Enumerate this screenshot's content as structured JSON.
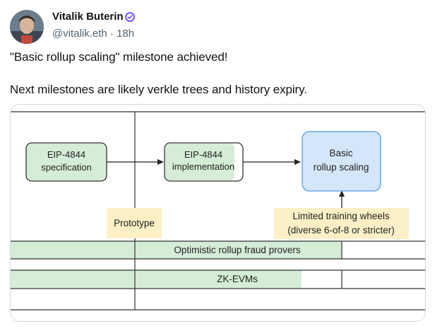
{
  "author": {
    "name": "Vitalik Buterin",
    "handle_time": "@vitalik.eth · 18h"
  },
  "tweet": {
    "line1": "\"Basic rollup scaling\" milestone achieved!",
    "line2": "Next milestones are likely verkle trees and history expiry."
  },
  "diagram": {
    "box_spec": [
      "EIP-4844",
      "specification"
    ],
    "box_impl": [
      "EIP-4844",
      "implementation"
    ],
    "box_basic": [
      "Basic",
      "rollup scaling"
    ],
    "prototype": "Prototype",
    "training": [
      "Limited training wheels",
      "(diverse 6-of-8 or stricter)"
    ],
    "fraud_provers": "Optimistic rollup fraud provers",
    "zk_evms": "ZK-EVMs"
  },
  "colors": {
    "verified_badge": "#7856ff",
    "box_green": "#d5ecd6",
    "box_blue": "#d3e6fa",
    "box_blue_border": "#6ca7e8",
    "label_yellow": "#fdf0c7",
    "progress_green": "#d5ecd6"
  }
}
